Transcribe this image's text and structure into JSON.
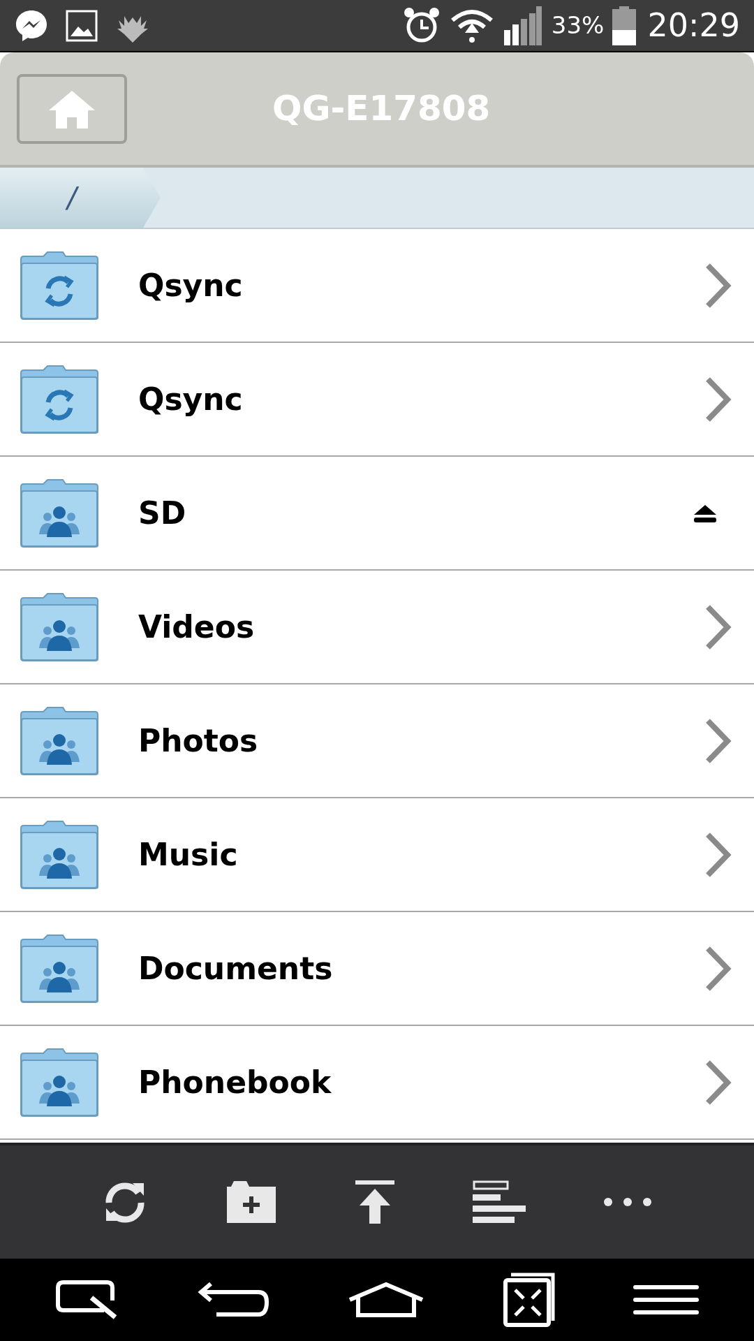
{
  "status_bar": {
    "battery": "33%",
    "time": "20:29"
  },
  "header": {
    "title": "QG-E17808"
  },
  "breadcrumb": {
    "path": "/"
  },
  "folders": [
    {
      "name": "Qsync",
      "kind": "sync",
      "ejectable": false
    },
    {
      "name": "Qsync",
      "kind": "sync",
      "ejectable": false
    },
    {
      "name": "SD",
      "kind": "shared",
      "ejectable": true
    },
    {
      "name": "Videos",
      "kind": "shared",
      "ejectable": false
    },
    {
      "name": "Photos",
      "kind": "shared",
      "ejectable": false
    },
    {
      "name": "Music",
      "kind": "shared",
      "ejectable": false
    },
    {
      "name": "Documents",
      "kind": "shared",
      "ejectable": false
    },
    {
      "name": "Phonebook",
      "kind": "shared",
      "ejectable": false
    }
  ]
}
